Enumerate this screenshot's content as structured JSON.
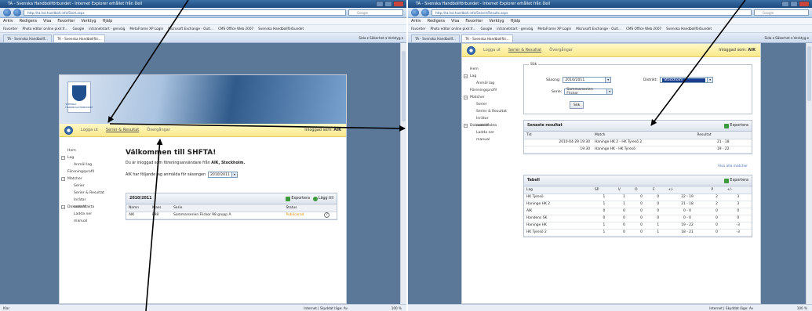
{
  "browser": {
    "title": "TA - Svenska Handbollförbundet - Internet Explorer erhållet från Dell",
    "url_left": "http://ta.hol.handboll.info/Start.aspx",
    "url_right": "http://ta.hol.handboll.info/Search/Results.aspx",
    "search_placeholder": "Google",
    "menu": [
      "Arkiv",
      "Redigera",
      "Visa",
      "Favoriter",
      "Verktyg",
      "Hjälp"
    ],
    "favorites": [
      "Favoriter",
      "Photo editor online pixlr.fr...",
      "Google",
      "intranetstart - genväg",
      "MetaFrame XP Login",
      "Microsoft Exchange - Outl...",
      "CMS Office Web 2007",
      "Svenska Handbollförbundet"
    ],
    "tabs": [
      "TA - Svenska Handbollf...",
      "TA - Svenska Handbollför..."
    ],
    "tab_tools": "Sida ▾  Säkerhet ▾  Verktyg ▾",
    "status_left": "Klar",
    "status_zone": "Internet | Skyddat läge: Av",
    "status_zoom": "100 %"
  },
  "nav": {
    "logout": "Logga ut",
    "series": "Serier & Resultat",
    "transfers": "Övergångar",
    "logged_in_prefix": "Inloggad som:",
    "logged_in_user": "AIK"
  },
  "logo_text": "SVENSKA HANDBOLLFÖRBUNDET",
  "sidebar": {
    "home": "Hem",
    "lag": "Lag",
    "anmal_lag": "Anmäl lag",
    "foreningsprofil": "Föreningsprofil",
    "matcher": "Matcher",
    "serier": "Serier",
    "serier_resultat": "Serier & Resultat",
    "inrapportera": "Inrätar matchfakta",
    "dokument": "Dokument",
    "ladda_ner": "Ladda ner manual"
  },
  "left_main": {
    "heading": "Välkommen till SHFTA!",
    "lead_prefix": "Du är inloggad som föreningsanvändare från",
    "lead_club": "AIK, Stockholm.",
    "season_text": "AIK har följande lag anmälda för säsongen",
    "season_value": "2010/2011",
    "grid_title": "2010/2011",
    "export_label": "Exportera",
    "add_label": "Lägg till",
    "columns": [
      "Namn",
      "Klass",
      "Serie",
      "Status"
    ],
    "rows": [
      {
        "namn": "AIK",
        "klass": "F98",
        "serie": "Sommarserien Flickor 98 grupp A",
        "status": "Publicerad"
      }
    ]
  },
  "search": {
    "legend": "Sök",
    "season_label": "Säsong:",
    "season_value": "2010/2011",
    "district_label": "Distrikt:",
    "district_value": "Stockholm",
    "series_label": "Serie:",
    "series_value": "Sommarserien Flickor",
    "submit": "Sök"
  },
  "latest": {
    "title": "Senaste resultat",
    "export_label": "Exportera",
    "columns": [
      "Tid",
      "Match",
      "Resultat"
    ],
    "rows": [
      {
        "tid": "2010-04-29 19:30",
        "match": "Haninge HK 2 - HK Tyresö 2",
        "resultat": "21 - 18"
      },
      {
        "tid": "19:30",
        "match": "Haninge HK - HK Tyresö",
        "resultat": "19 - 22"
      }
    ],
    "more": "Visa alla matcher"
  },
  "table": {
    "title": "Tabell",
    "export_label": "Exportera",
    "columns": [
      "Lag",
      "SP",
      "V",
      "O",
      "F",
      "+/-",
      "P",
      "+/-"
    ],
    "rows": [
      {
        "lag": "HK Tyresö",
        "sp": "1",
        "v": "1",
        "o": "0",
        "f": "0",
        "gd": "22 - 19",
        "p": "2",
        "pm": "3"
      },
      {
        "lag": "Haninge HK 2",
        "sp": "1",
        "v": "1",
        "o": "0",
        "f": "0",
        "gd": "21 - 18",
        "p": "2",
        "pm": "3"
      },
      {
        "lag": "AIK",
        "sp": "0",
        "v": "0",
        "o": "0",
        "f": "0",
        "gd": "0 - 0",
        "p": "0",
        "pm": "0"
      },
      {
        "lag": "Handens SK",
        "sp": "0",
        "v": "0",
        "o": "0",
        "f": "0",
        "gd": "0 - 0",
        "p": "0",
        "pm": "0"
      },
      {
        "lag": "Haninge HK",
        "sp": "1",
        "v": "0",
        "o": "0",
        "f": "1",
        "gd": "19 - 22",
        "p": "0",
        "pm": "-3"
      },
      {
        "lag": "HK Tyresö 2",
        "sp": "1",
        "v": "0",
        "o": "0",
        "f": "1",
        "gd": "18 - 21",
        "p": "0",
        "pm": "-3"
      }
    ]
  }
}
